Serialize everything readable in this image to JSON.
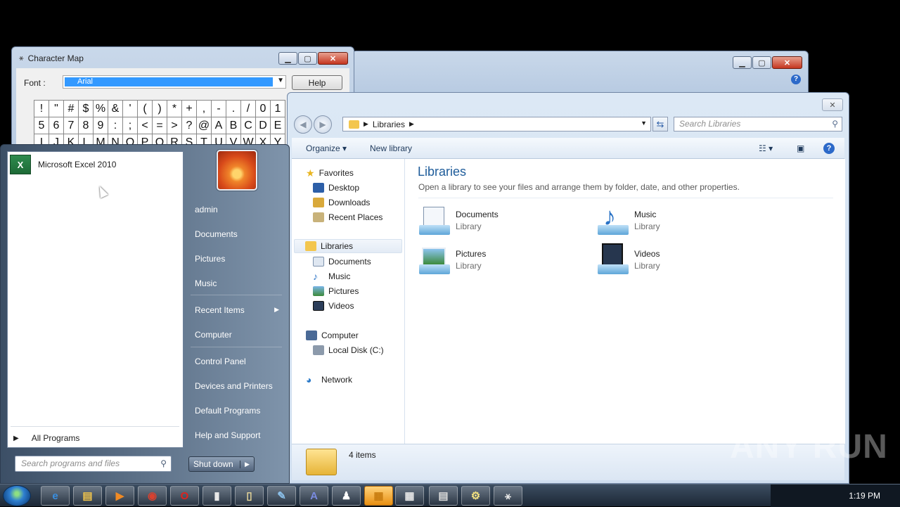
{
  "charmap": {
    "title": "Character Map",
    "font_label": "Font :",
    "font_value": "Arial",
    "help_label": "Help",
    "chars": [
      "!",
      "\"",
      "#",
      "$",
      "%",
      "&",
      "'",
      "(",
      ")",
      "*",
      "+",
      ",",
      "-",
      ".",
      "/",
      "0",
      "1",
      "5",
      "6",
      "7",
      "8",
      "9",
      ":",
      ";",
      "<",
      "=",
      ">",
      "?",
      "@",
      "A",
      "B",
      "C",
      "D",
      "E",
      "I",
      "J",
      "K",
      "L",
      "M",
      "N",
      "O",
      "P",
      "Q",
      "R",
      "S",
      "T",
      "U",
      "V",
      "W",
      "X",
      "Y"
    ]
  },
  "explorer": {
    "breadcrumb": "Libraries",
    "search_placeholder": "Search Libraries",
    "commands": {
      "organize": "Organize",
      "new_library": "New library"
    },
    "nav": {
      "favorites": "Favorites",
      "desktop": "Desktop",
      "downloads": "Downloads",
      "recent_places": "Recent Places",
      "libraries": "Libraries",
      "documents": "Documents",
      "music": "Music",
      "pictures": "Pictures",
      "videos": "Videos",
      "computer": "Computer",
      "local_disk": "Local Disk (C:)",
      "network": "Network"
    },
    "heading": "Libraries",
    "subheading": "Open a library to see your files and arrange them by folder, date, and other properties.",
    "libraries": [
      {
        "name": "Documents",
        "kind": "Library"
      },
      {
        "name": "Music",
        "kind": "Library"
      },
      {
        "name": "Pictures",
        "kind": "Library"
      },
      {
        "name": "Videos",
        "kind": "Library"
      }
    ],
    "status": "4 items"
  },
  "startmenu": {
    "pinned_program": "Microsoft Excel 2010",
    "all_programs": "All Programs",
    "search_placeholder": "Search programs and files",
    "shutdown": "Shut down",
    "right": {
      "user": "admin",
      "documents": "Documents",
      "pictures": "Pictures",
      "music": "Music",
      "recent_items": "Recent Items",
      "computer": "Computer",
      "control_panel": "Control Panel",
      "devices_printers": "Devices and Printers",
      "default_programs": "Default Programs",
      "help_support": "Help and Support"
    }
  },
  "taskbar": {
    "clock": "1:19 PM",
    "icons": [
      "ie-icon",
      "explorer-icon",
      "media-player-icon",
      "chrome-icon",
      "opera-icon",
      "app-icon",
      "notepad-icon",
      "paint-icon",
      "font-icon",
      "network-user-icon",
      "folder-icon",
      "calculator-icon",
      "printer-icon",
      "tools-icon",
      "charmap-icon"
    ]
  },
  "watermark": "ANY RUN"
}
